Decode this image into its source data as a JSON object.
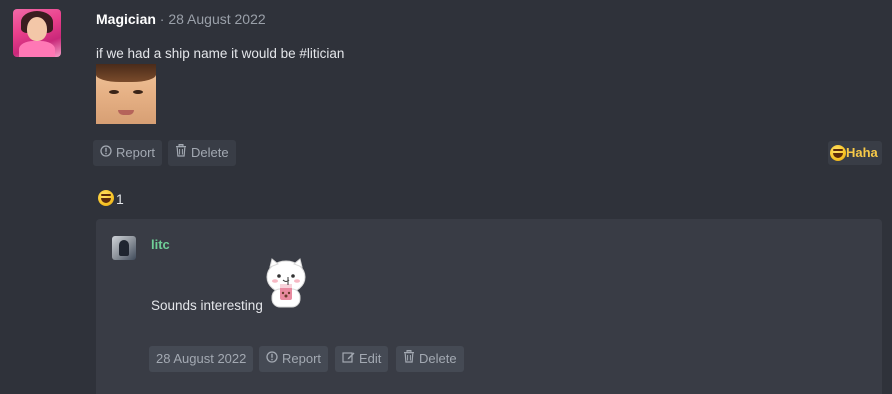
{
  "post": {
    "author": "Magician",
    "separator": " · ",
    "date": "28 August 2022",
    "text": "if we had a ship name it would be #litician",
    "image_icon": "face-photo",
    "actions": {
      "report_label": "Report",
      "delete_label": "Delete"
    },
    "reaction_button": {
      "label": "Haha",
      "icon": "rofl-emoji"
    },
    "reaction_summary": {
      "icon": "rofl-emoji",
      "count": "1"
    }
  },
  "reply": {
    "author": "litc",
    "text": "Sounds interesting",
    "sticker_icon": "cat-sticker",
    "date": "28 August 2022",
    "actions": {
      "report_label": "Report",
      "edit_label": "Edit",
      "delete_label": "Delete"
    }
  },
  "colors": {
    "background": "#2f323a",
    "reply_background": "#393c45",
    "reply_author": "#6fcf97",
    "haha_label": "#f7c948"
  }
}
